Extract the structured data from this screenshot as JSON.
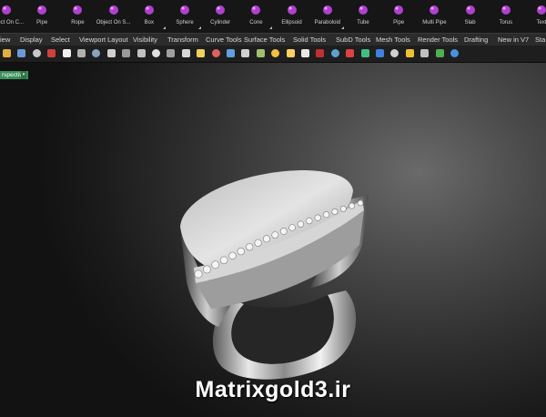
{
  "shelf": {
    "items": [
      {
        "label": "Object On C...",
        "icon": "curve-points-icon"
      },
      {
        "label": "Pipe",
        "icon": "pipe-icon"
      },
      {
        "label": "Rope",
        "icon": "rope-icon"
      },
      {
        "label": "Object On S...",
        "icon": "surface-points-icon"
      },
      {
        "label": "Box",
        "icon": "box-icon"
      },
      {
        "label": "Sphere",
        "icon": "sphere-icon"
      },
      {
        "label": "Cylinder",
        "icon": "cylinder-icon"
      },
      {
        "label": "Cone",
        "icon": "cone-icon"
      },
      {
        "label": "Ellipsoid",
        "icon": "ellipsoid-icon"
      },
      {
        "label": "Paraboloid",
        "icon": "paraboloid-icon"
      },
      {
        "label": "Tube",
        "icon": "tube-icon"
      },
      {
        "label": "Pipe",
        "icon": "pipe-solid-icon"
      },
      {
        "label": "Multi Pipe",
        "icon": "multi-pipe-icon"
      },
      {
        "label": "Slab",
        "icon": "slab-icon"
      },
      {
        "label": "Torus",
        "icon": "torus-icon"
      },
      {
        "label": "Text",
        "icon": "text-icon"
      }
    ],
    "icon_color": "#b040d0"
  },
  "tabs": [
    "iew",
    "Display",
    "Select",
    "Viewport Layout",
    "Visibility",
    "Transform",
    "Curve Tools",
    "Surface Tools",
    "Solid Tools",
    "SubD Tools",
    "Mesh Tools",
    "Render Tools",
    "Drafting",
    "New in V7",
    "Sta"
  ],
  "toolbar": {
    "icons": [
      "open-icon",
      "save-icon",
      "print-icon",
      "cut-icon",
      "copy-icon",
      "paste-icon",
      "undo-icon",
      "select-icon",
      "pan-icon",
      "rotate-icon",
      "zoom-icon",
      "zoom-extents-icon",
      "zoom-window-icon",
      "layout-icon",
      "point-icon",
      "curve-icon",
      "circle-icon",
      "arc-icon",
      "polyline-icon",
      "light-icon",
      "rectangle-icon",
      "shade-icon",
      "render-icon",
      "material-icon",
      "color-wheel-icon",
      "sphere-render-icon",
      "environment-icon",
      "sun-icon",
      "settings-icon",
      "globe-icon",
      "help-icon"
    ]
  },
  "viewport": {
    "label": "rspective",
    "dropdown": "▾"
  },
  "watermark": "Matrixgold3.ir"
}
